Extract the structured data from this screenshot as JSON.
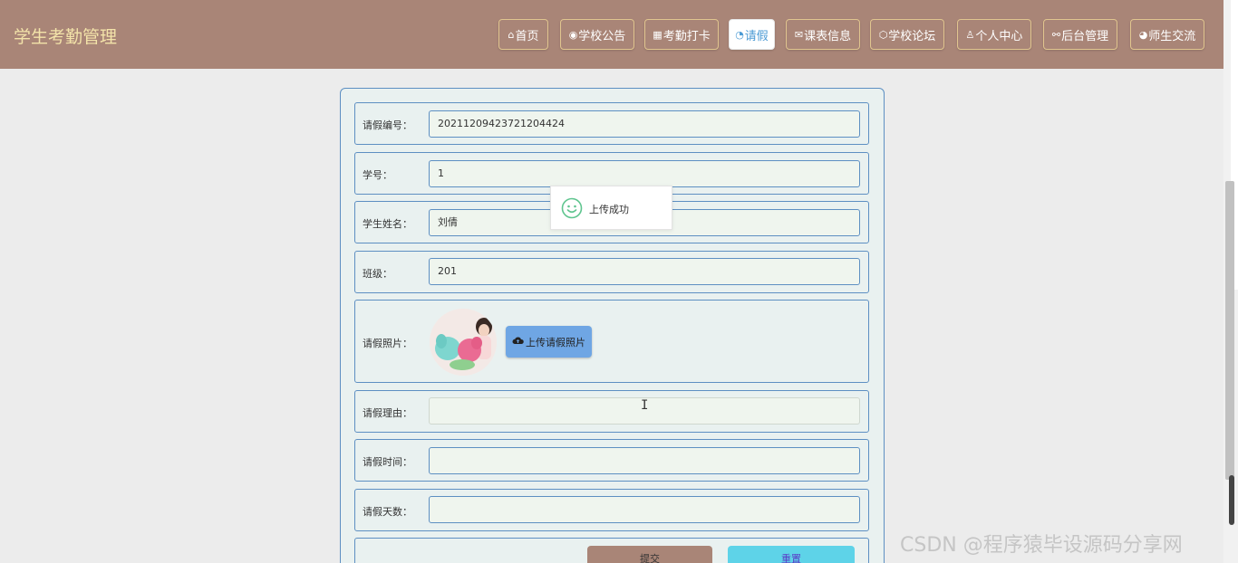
{
  "header": {
    "title": "学生考勤管理"
  },
  "nav": [
    {
      "label": "首页",
      "icon": "home-icon",
      "glyph": "⌂"
    },
    {
      "label": "学校公告",
      "icon": "globe-icon",
      "glyph": "◉"
    },
    {
      "label": "考勤打卡",
      "icon": "qrcode-icon",
      "glyph": "▦"
    },
    {
      "label": "请假",
      "icon": "dashboard-icon",
      "glyph": "◔",
      "active": true
    },
    {
      "label": "课表信息",
      "icon": "mail-icon",
      "glyph": "✉"
    },
    {
      "label": "学校论坛",
      "icon": "cube-icon",
      "glyph": "⬡"
    },
    {
      "label": "个人中心",
      "icon": "user-icon",
      "glyph": "♙"
    },
    {
      "label": "后台管理",
      "icon": "link-icon",
      "glyph": "⚯"
    },
    {
      "label": "师生交流",
      "icon": "chat-icon",
      "glyph": "◕"
    }
  ],
  "form": {
    "leave_no": {
      "label": "请假编号：",
      "value": "20211209423721204424"
    },
    "student_no": {
      "label": "学号：",
      "value": "1"
    },
    "student_name": {
      "label": "学生姓名：",
      "value": "刘倩"
    },
    "class": {
      "label": "班级：",
      "value": "201"
    },
    "photo": {
      "label": "请假照片：",
      "upload_label": "上传请假照片"
    },
    "reason": {
      "label": "请假理由：",
      "value": ""
    },
    "time": {
      "label": "请假时间：",
      "value": ""
    },
    "days": {
      "label": "请假天数：",
      "value": ""
    },
    "submit_label": "提交",
    "reset_label": "重置"
  },
  "toast": {
    "text": "上传成功"
  },
  "watermark": "CSDN @程序猿毕设源码分享网",
  "colors": {
    "header": "#a98577",
    "border": "#5d8fc2",
    "active_text": "#4a9ad4"
  }
}
